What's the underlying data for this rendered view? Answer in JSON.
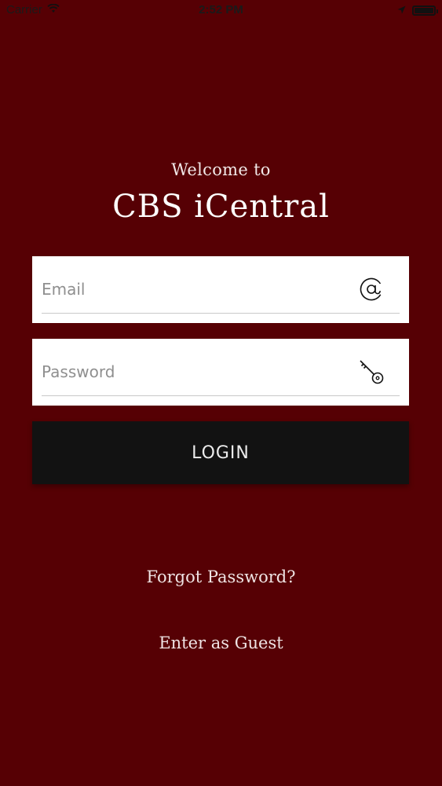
{
  "status_bar": {
    "carrier": "Carrier",
    "time": "2:52 PM",
    "icons": [
      "wifi-icon",
      "location-arrow-icon",
      "battery-icon"
    ]
  },
  "welcome_text": "Welcome to",
  "app_title": "CBS iCentral",
  "email_field": {
    "placeholder": "Email",
    "value": "",
    "icon": "at-sign-icon"
  },
  "password_field": {
    "placeholder": "Password",
    "value": "",
    "icon": "key-icon"
  },
  "login_button": {
    "label": "LOGIN"
  },
  "forgot_password_link": "Forgot Password?",
  "guest_link": "Enter as Guest",
  "colors": {
    "background": "#560004",
    "button": "#121212",
    "field": "#ffffff",
    "text_light": "#ffffff"
  }
}
